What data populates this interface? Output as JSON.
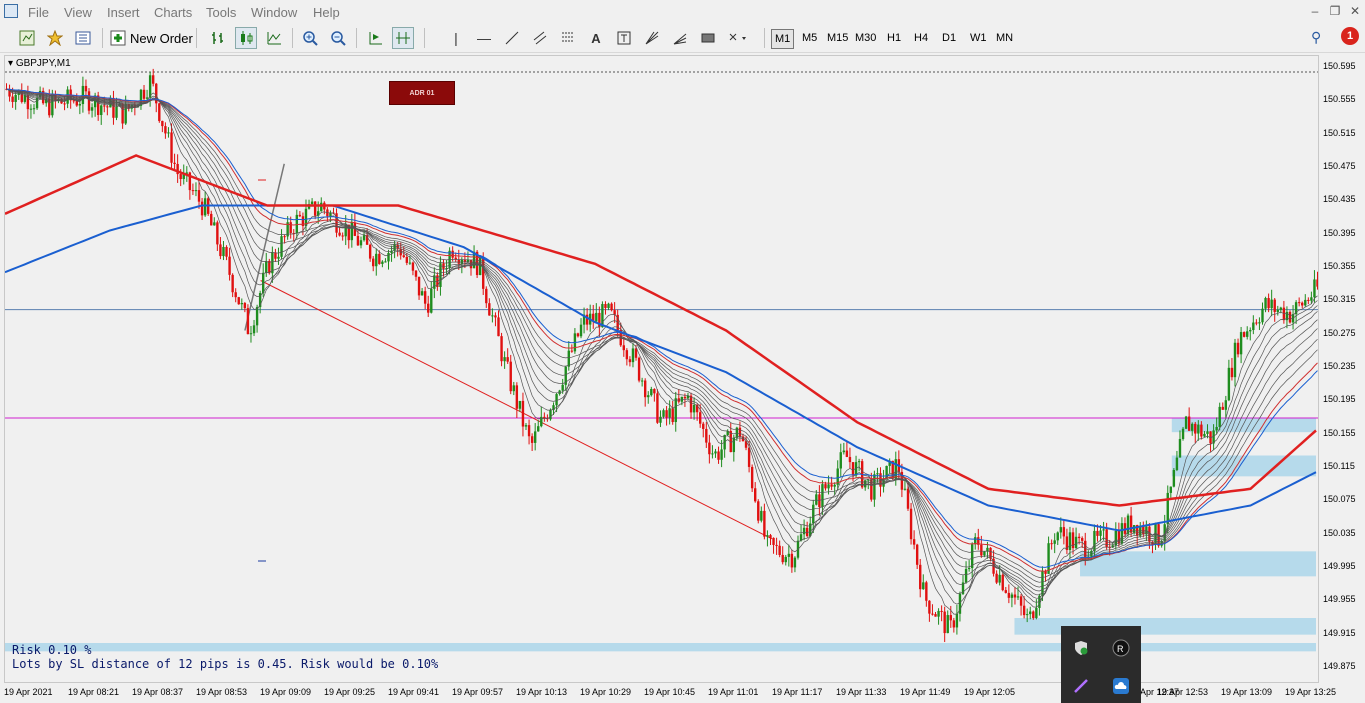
{
  "menu": {
    "items": [
      "File",
      "View",
      "Insert",
      "Charts",
      "Tools",
      "Window",
      "Help"
    ]
  },
  "toolbar": {
    "new_order_label": "New Order",
    "timeframes": [
      "M1",
      "M5",
      "M15",
      "M30",
      "H1",
      "H4",
      "D1",
      "W1",
      "MN"
    ],
    "active_timeframe": "M1",
    "notification_count": "1"
  },
  "chart": {
    "symbol_label": "GBPJPY,M1",
    "adr_button_label": "ADR 01",
    "checkbox_mark": "✓",
    "risk_line": "Risk 0.10 %",
    "lots_line": "Lots by SL distance of 12 pips is 0.45. Risk would be 0.10%",
    "colors": {
      "bull": "#1e8c1e",
      "bear": "#e01010",
      "ema_slow": "#e02020",
      "ema_blue": "#1a5fd0",
      "ribbon": "#555555",
      "hline_blue": "#5a7fb0",
      "hline_magenta": "#d020d0",
      "zone": "#a8d4ea"
    }
  },
  "chart_data": {
    "type": "candlestick",
    "symbol": "GBPJPY",
    "timeframe": "M1",
    "y_ticks": [
      "150.595",
      "150.555",
      "150.515",
      "150.475",
      "150.435",
      "150.395",
      "150.355",
      "150.315",
      "150.275",
      "150.235",
      "150.195",
      "150.155",
      "150.115",
      "150.075",
      "150.035",
      "149.995",
      "149.955",
      "149.915",
      "149.875"
    ],
    "ylim": [
      149.875,
      150.595
    ],
    "x_ticks": [
      "19 Apr 2021",
      "19 Apr 08:21",
      "19 Apr 08:37",
      "19 Apr 08:53",
      "19 Apr 09:09",
      "19 Apr 09:25",
      "19 Apr 09:41",
      "19 Apr 09:57",
      "19 Apr 10:13",
      "19 Apr 10:29",
      "19 Apr 10:45",
      "19 Apr 11:01",
      "19 Apr 11:17",
      "19 Apr 11:33",
      "19 Apr 11:49",
      "19 Apr 12:05",
      "19 Apr 12:37",
      "19 Apr 12:53",
      "19 Apr 13:09",
      "19 Apr 13:25"
    ],
    "horizontal_lines": [
      150.305,
      150.175
    ],
    "close_path": [
      [
        0,
        150.57
      ],
      [
        0.03,
        150.55
      ],
      [
        0.06,
        150.56
      ],
      [
        0.09,
        150.54
      ],
      [
        0.11,
        150.58
      ],
      [
        0.13,
        150.47
      ],
      [
        0.15,
        150.43
      ],
      [
        0.17,
        150.35
      ],
      [
        0.185,
        150.28
      ],
      [
        0.2,
        150.36
      ],
      [
        0.22,
        150.41
      ],
      [
        0.24,
        150.43
      ],
      [
        0.26,
        150.4
      ],
      [
        0.28,
        150.37
      ],
      [
        0.3,
        150.38
      ],
      [
        0.32,
        150.31
      ],
      [
        0.34,
        150.38
      ],
      [
        0.36,
        150.36
      ],
      [
        0.38,
        150.24
      ],
      [
        0.4,
        150.14
      ],
      [
        0.42,
        150.21
      ],
      [
        0.44,
        150.29
      ],
      [
        0.46,
        150.3
      ],
      [
        0.48,
        150.24
      ],
      [
        0.5,
        150.17
      ],
      [
        0.52,
        150.2
      ],
      [
        0.54,
        150.13
      ],
      [
        0.56,
        150.16
      ],
      [
        0.58,
        150.02
      ],
      [
        0.6,
        150.01
      ],
      [
        0.62,
        150.08
      ],
      [
        0.64,
        150.13
      ],
      [
        0.66,
        150.09
      ],
      [
        0.68,
        150.12
      ],
      [
        0.7,
        149.96
      ],
      [
        0.72,
        149.92
      ],
      [
        0.74,
        150.03
      ],
      [
        0.76,
        149.98
      ],
      [
        0.78,
        149.93
      ],
      [
        0.8,
        150.04
      ],
      [
        0.82,
        150.02
      ],
      [
        0.84,
        150.03
      ],
      [
        0.86,
        150.05
      ],
      [
        0.88,
        150.03
      ],
      [
        0.9,
        150.17
      ],
      [
        0.92,
        150.15
      ],
      [
        0.94,
        150.27
      ],
      [
        0.96,
        150.31
      ],
      [
        0.98,
        150.3
      ],
      [
        1.0,
        150.33
      ]
    ],
    "ema_red_path": [
      [
        0,
        150.42
      ],
      [
        0.1,
        150.49
      ],
      [
        0.2,
        150.43
      ],
      [
        0.3,
        150.43
      ],
      [
        0.45,
        150.36
      ],
      [
        0.55,
        150.28
      ],
      [
        0.65,
        150.17
      ],
      [
        0.75,
        150.09
      ],
      [
        0.85,
        150.07
      ],
      [
        0.95,
        150.09
      ],
      [
        1.0,
        150.16
      ]
    ],
    "ema_blue_path": [
      [
        0,
        150.35
      ],
      [
        0.08,
        150.4
      ],
      [
        0.15,
        150.43
      ],
      [
        0.25,
        150.43
      ],
      [
        0.35,
        150.38
      ],
      [
        0.45,
        150.29
      ],
      [
        0.55,
        150.23
      ],
      [
        0.65,
        150.14
      ],
      [
        0.75,
        150.07
      ],
      [
        0.85,
        150.04
      ],
      [
        0.95,
        150.07
      ],
      [
        1.0,
        150.11
      ]
    ],
    "trend_line": [
      [
        150.34
      ],
      [
        150.03
      ]
    ],
    "zones": [
      [
        150.175,
        150.158
      ],
      [
        150.13,
        150.105
      ],
      [
        150.015,
        149.985
      ],
      [
        149.935,
        149.915
      ],
      [
        149.905,
        149.895
      ]
    ]
  }
}
